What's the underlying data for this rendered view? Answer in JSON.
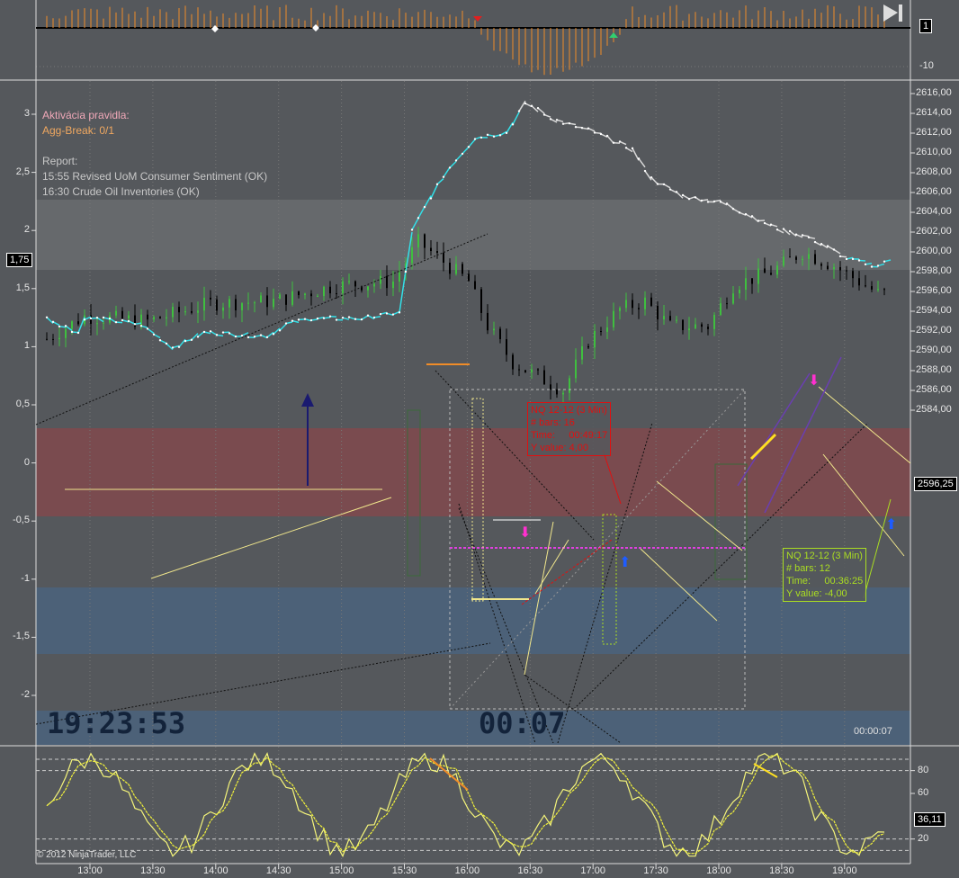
{
  "info": {
    "rule_title": "Aktivácia pravidla:",
    "rule_value": "Agg-Break: 0/1",
    "report_title": "Report:",
    "report_lines": [
      "15:55 Revised UoM Consumer Sentiment (OK)",
      "16:30 Crude Oil Inventories (OK)"
    ]
  },
  "clocks": {
    "time": "19:23:53",
    "countdown": "00:07",
    "bar_timer": "00:00:07"
  },
  "copyright": "© 2012 NinjaTrader, LLC",
  "measure_red": {
    "title": "NQ 12-12 (3 Min)",
    "bars": "# bars: 16",
    "time": "Time:     00:49:17",
    "yvalue": "Y value: 4,00"
  },
  "measure_green": {
    "title": "NQ 12-12 (3 Min)",
    "bars": "# bars: 12",
    "time": "Time:     00:36:25",
    "yvalue": "Y value: -4,00"
  },
  "tags": {
    "top": "1",
    "left": "1,75",
    "price": "2596,25",
    "osc": "36,11"
  },
  "colors": {
    "bg": "#55585c",
    "red_band": "#7a4b4f",
    "blue_band": "#4c6178",
    "cyan": "#33e0e8",
    "up": "#3fbf3f",
    "down": "#000000",
    "osc": "#f2f23a",
    "histogram": "#f08c28"
  },
  "chart_data": [
    {
      "type": "bar",
      "name": "top-histogram",
      "yticks": [
        "1",
        "-10"
      ],
      "note": "positive bars most of session, negative dip approx 16:15-17:15"
    },
    {
      "type": "line",
      "name": "main-price",
      "xticks": [
        "13:00",
        "13:30",
        "14:00",
        "14:30",
        "15:00",
        "15:30",
        "16:00",
        "16:30",
        "17:00",
        "17:30",
        "18:00",
        "18:30",
        "19:00"
      ],
      "right_yticks": [
        "2616,00",
        "2614,00",
        "2612,00",
        "2610,00",
        "2608,00",
        "2606,00",
        "2604,00",
        "2602,00",
        "2600,00",
        "2598,00",
        "2596,00",
        "2594,00",
        "2592,00",
        "2590,00",
        "2588,00",
        "2586,00",
        "2584,00"
      ],
      "left_yticks": [
        "3",
        "2,5",
        "2",
        "1,5",
        "1",
        "0,5",
        "0",
        "-0,5",
        "-1",
        "-1,5",
        "-2"
      ],
      "ylim_right": [
        2583,
        2617
      ],
      "price_path": [
        [
          0,
          2591.2
        ],
        [
          6,
          2593.5
        ],
        [
          16,
          2593
        ],
        [
          26,
          2594.8
        ],
        [
          36,
          2595
        ],
        [
          46,
          2596.6
        ],
        [
          55,
          2597
        ],
        [
          59,
          2601
        ],
        [
          63,
          2599
        ],
        [
          67,
          2597
        ],
        [
          70,
          2592.5
        ],
        [
          74,
          2588.8
        ],
        [
          82,
          2586
        ],
        [
          86,
          2591
        ],
        [
          91,
          2594.2
        ],
        [
          95,
          2595
        ],
        [
          99,
          2592.5
        ],
        [
          105,
          2592.5
        ],
        [
          109,
          2596.6
        ],
        [
          115,
          2598
        ],
        [
          120,
          2600
        ],
        [
          125,
          2598.6
        ],
        [
          132,
          2595.8
        ]
      ],
      "ratio_series_left": [
        [
          0,
          1.25
        ],
        [
          5,
          1.13
        ],
        [
          6,
          1.26
        ],
        [
          15,
          1.2
        ],
        [
          20,
          1.0
        ],
        [
          25,
          1.13
        ],
        [
          35,
          1.1
        ],
        [
          38,
          1.2
        ],
        [
          42,
          1.25
        ],
        [
          50,
          1.25
        ],
        [
          56,
          1.3
        ],
        [
          58,
          2.0
        ],
        [
          61,
          2.3
        ],
        [
          64,
          2.55
        ],
        [
          68,
          2.8
        ],
        [
          73,
          2.85
        ],
        [
          76,
          3.1
        ],
        [
          81,
          2.95
        ],
        [
          87,
          2.85
        ],
        [
          93,
          2.7
        ],
        [
          96,
          2.45
        ],
        [
          101,
          2.3
        ],
        [
          107,
          2.25
        ],
        [
          113,
          2.1
        ],
        [
          117,
          2.0
        ],
        [
          121,
          1.95
        ],
        [
          127,
          1.77
        ],
        [
          132,
          1.7
        ],
        [
          134,
          1.75
        ]
      ]
    },
    {
      "type": "line",
      "name": "stochastic",
      "yticks": [
        "80",
        "60",
        "20"
      ],
      "ylim": [
        0,
        100
      ],
      "last_value": 36.11
    }
  ]
}
